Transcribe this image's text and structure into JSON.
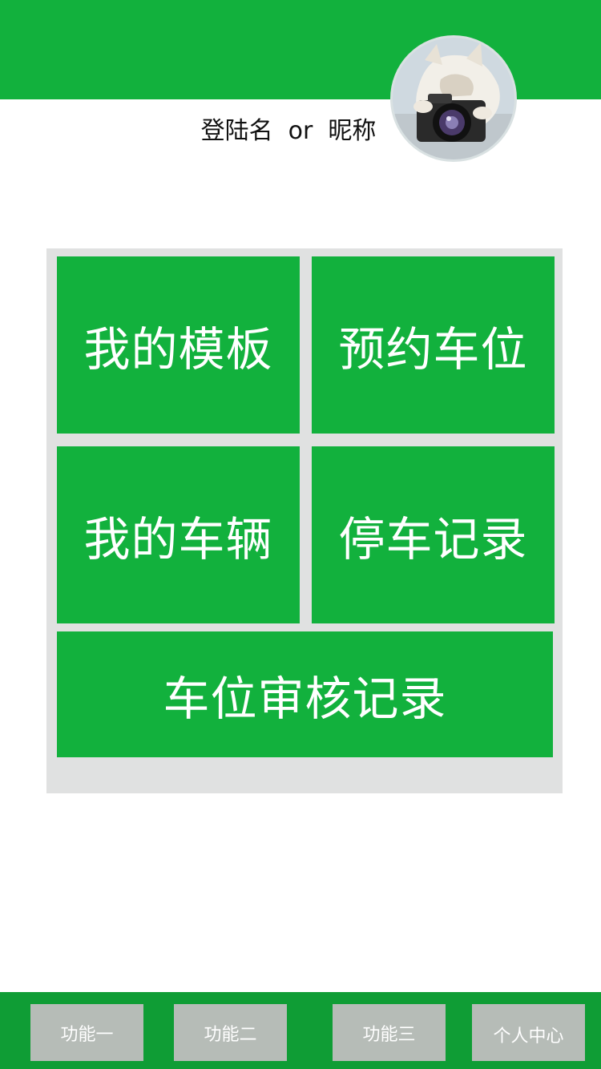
{
  "header": {
    "username": "登陆名  or  昵称",
    "brand_color": "#12b13d",
    "avatar_icon": "avatar-photo"
  },
  "menu": {
    "tiles": [
      {
        "label": "我的模板"
      },
      {
        "label": "预约车位"
      },
      {
        "label": "我的车辆"
      },
      {
        "label": "停车记录"
      },
      {
        "label": "车位审核记录"
      }
    ],
    "tile_color": "#12b13d",
    "panel_color": "#e0e1e1"
  },
  "bottom_nav": {
    "bar_color": "#0f9d35",
    "items": [
      {
        "label": "功能一"
      },
      {
        "label": "功能二"
      },
      {
        "label": "功能三"
      },
      {
        "label": "个人中心"
      }
    ]
  }
}
